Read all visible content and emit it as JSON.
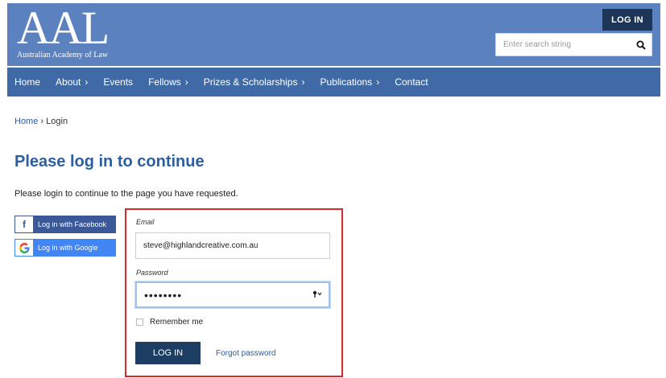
{
  "header": {
    "logo_text": "AAL",
    "logo_subtitle": "Australian Academy of Law",
    "login_button": "LOG IN",
    "search_placeholder": "Enter search string",
    "search_icon": "search-icon"
  },
  "nav": {
    "items": [
      {
        "label": "Home",
        "chevron": ""
      },
      {
        "label": "About",
        "chevron": "›"
      },
      {
        "label": "Events",
        "chevron": ""
      },
      {
        "label": "Fellows",
        "chevron": "›"
      },
      {
        "label": "Prizes & Scholarships",
        "chevron": "›"
      },
      {
        "label": "Publications",
        "chevron": "›"
      },
      {
        "label": "Contact",
        "chevron": ""
      }
    ]
  },
  "breadcrumb": {
    "home": "Home",
    "separator": "›",
    "current": "Login"
  },
  "main": {
    "title": "Please log in to continue",
    "intro": "Please login to continue to the page you have requested."
  },
  "social": {
    "facebook_label": "Log in with Facebook",
    "facebook_icon": "f",
    "google_label": "Log in with Google"
  },
  "form": {
    "email_label": "Email",
    "email_value": "steve@highlandcreative.com.au",
    "password_label": "Password",
    "password_value": "••••••••",
    "remember_label": "Remember me",
    "submit_label": "LOG IN",
    "forgot_label": "Forgot password"
  },
  "colors": {
    "header_bg": "#5b81bf",
    "nav_bg": "#3f6aa6",
    "title": "#2c5ea0",
    "highlight_border": "#d42a2a",
    "button_dark": "#1d3d63"
  }
}
